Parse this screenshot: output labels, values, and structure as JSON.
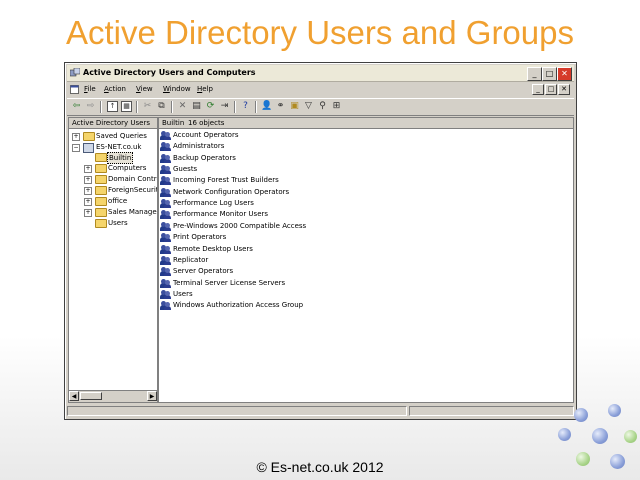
{
  "slide": {
    "title": "Active Directory Users and Groups",
    "footer": "© Es-net.co.uk 2012"
  },
  "window": {
    "title": "Active Directory Users and Computers",
    "buttons": {
      "minimize": "_",
      "maximize": "□",
      "close": "✕"
    },
    "menu": [
      {
        "underline": "F",
        "rest": "ile"
      },
      {
        "underline": "A",
        "rest": "ction"
      },
      {
        "underline": "V",
        "rest": "iew"
      },
      {
        "underline": "W",
        "rest": "indow"
      },
      {
        "underline": "H",
        "rest": "elp"
      }
    ],
    "mdi_buttons": [
      "_",
      "□",
      "✕"
    ]
  },
  "toolbar": {
    "icons": [
      "back-arrow-icon",
      "forward-arrow-icon",
      "up-level-icon",
      "show-tree-icon",
      "cut-icon",
      "copy-icon",
      "delete-icon",
      "properties-icon",
      "refresh-icon",
      "export-list-icon",
      "help-icon",
      "new-user-icon",
      "new-group-icon",
      "new-ou-icon",
      "filter-icon",
      "find-icon",
      "add-to-group-icon"
    ]
  },
  "tree": {
    "header": "Active Directory Users",
    "items": [
      {
        "label": "Saved Queries",
        "level": 1,
        "expander": "+",
        "icon": "folder"
      },
      {
        "label": "ES-NET.co.uk",
        "level": 1,
        "expander": "−",
        "icon": "domain"
      },
      {
        "label": "Builtin",
        "level": 2,
        "expander": "",
        "icon": "folder",
        "selected": true
      },
      {
        "label": "Computers",
        "level": 2,
        "expander": "+",
        "icon": "folder"
      },
      {
        "label": "Domain Contro",
        "level": 2,
        "expander": "+",
        "icon": "folder"
      },
      {
        "label": "ForeignSecurit",
        "level": 2,
        "expander": "+",
        "icon": "folder"
      },
      {
        "label": "office",
        "level": 2,
        "expander": "+",
        "icon": "folder"
      },
      {
        "label": "Sales Manager",
        "level": 2,
        "expander": "+",
        "icon": "folder"
      },
      {
        "label": "Users",
        "level": 2,
        "expander": "",
        "icon": "folder"
      }
    ]
  },
  "list": {
    "container": "Builtin",
    "count": "16 objects",
    "items": [
      "Account Operators",
      "Administrators",
      "Backup Operators",
      "Guests",
      "Incoming Forest Trust Builders",
      "Network Configuration Operators",
      "Performance Log Users",
      "Performance Monitor Users",
      "Pre-Windows 2000 Compatible Access",
      "Print Operators",
      "Remote Desktop Users",
      "Replicator",
      "Server Operators",
      "Terminal Server License Servers",
      "Users",
      "Windows Authorization Access Group"
    ]
  },
  "scrollbar": {
    "left_arrow": "◀",
    "right_arrow": "▶"
  },
  "colors": {
    "title_orange": "#f0a030",
    "window_chrome": "#d4d0c8",
    "close_red": "#d63a2a"
  }
}
